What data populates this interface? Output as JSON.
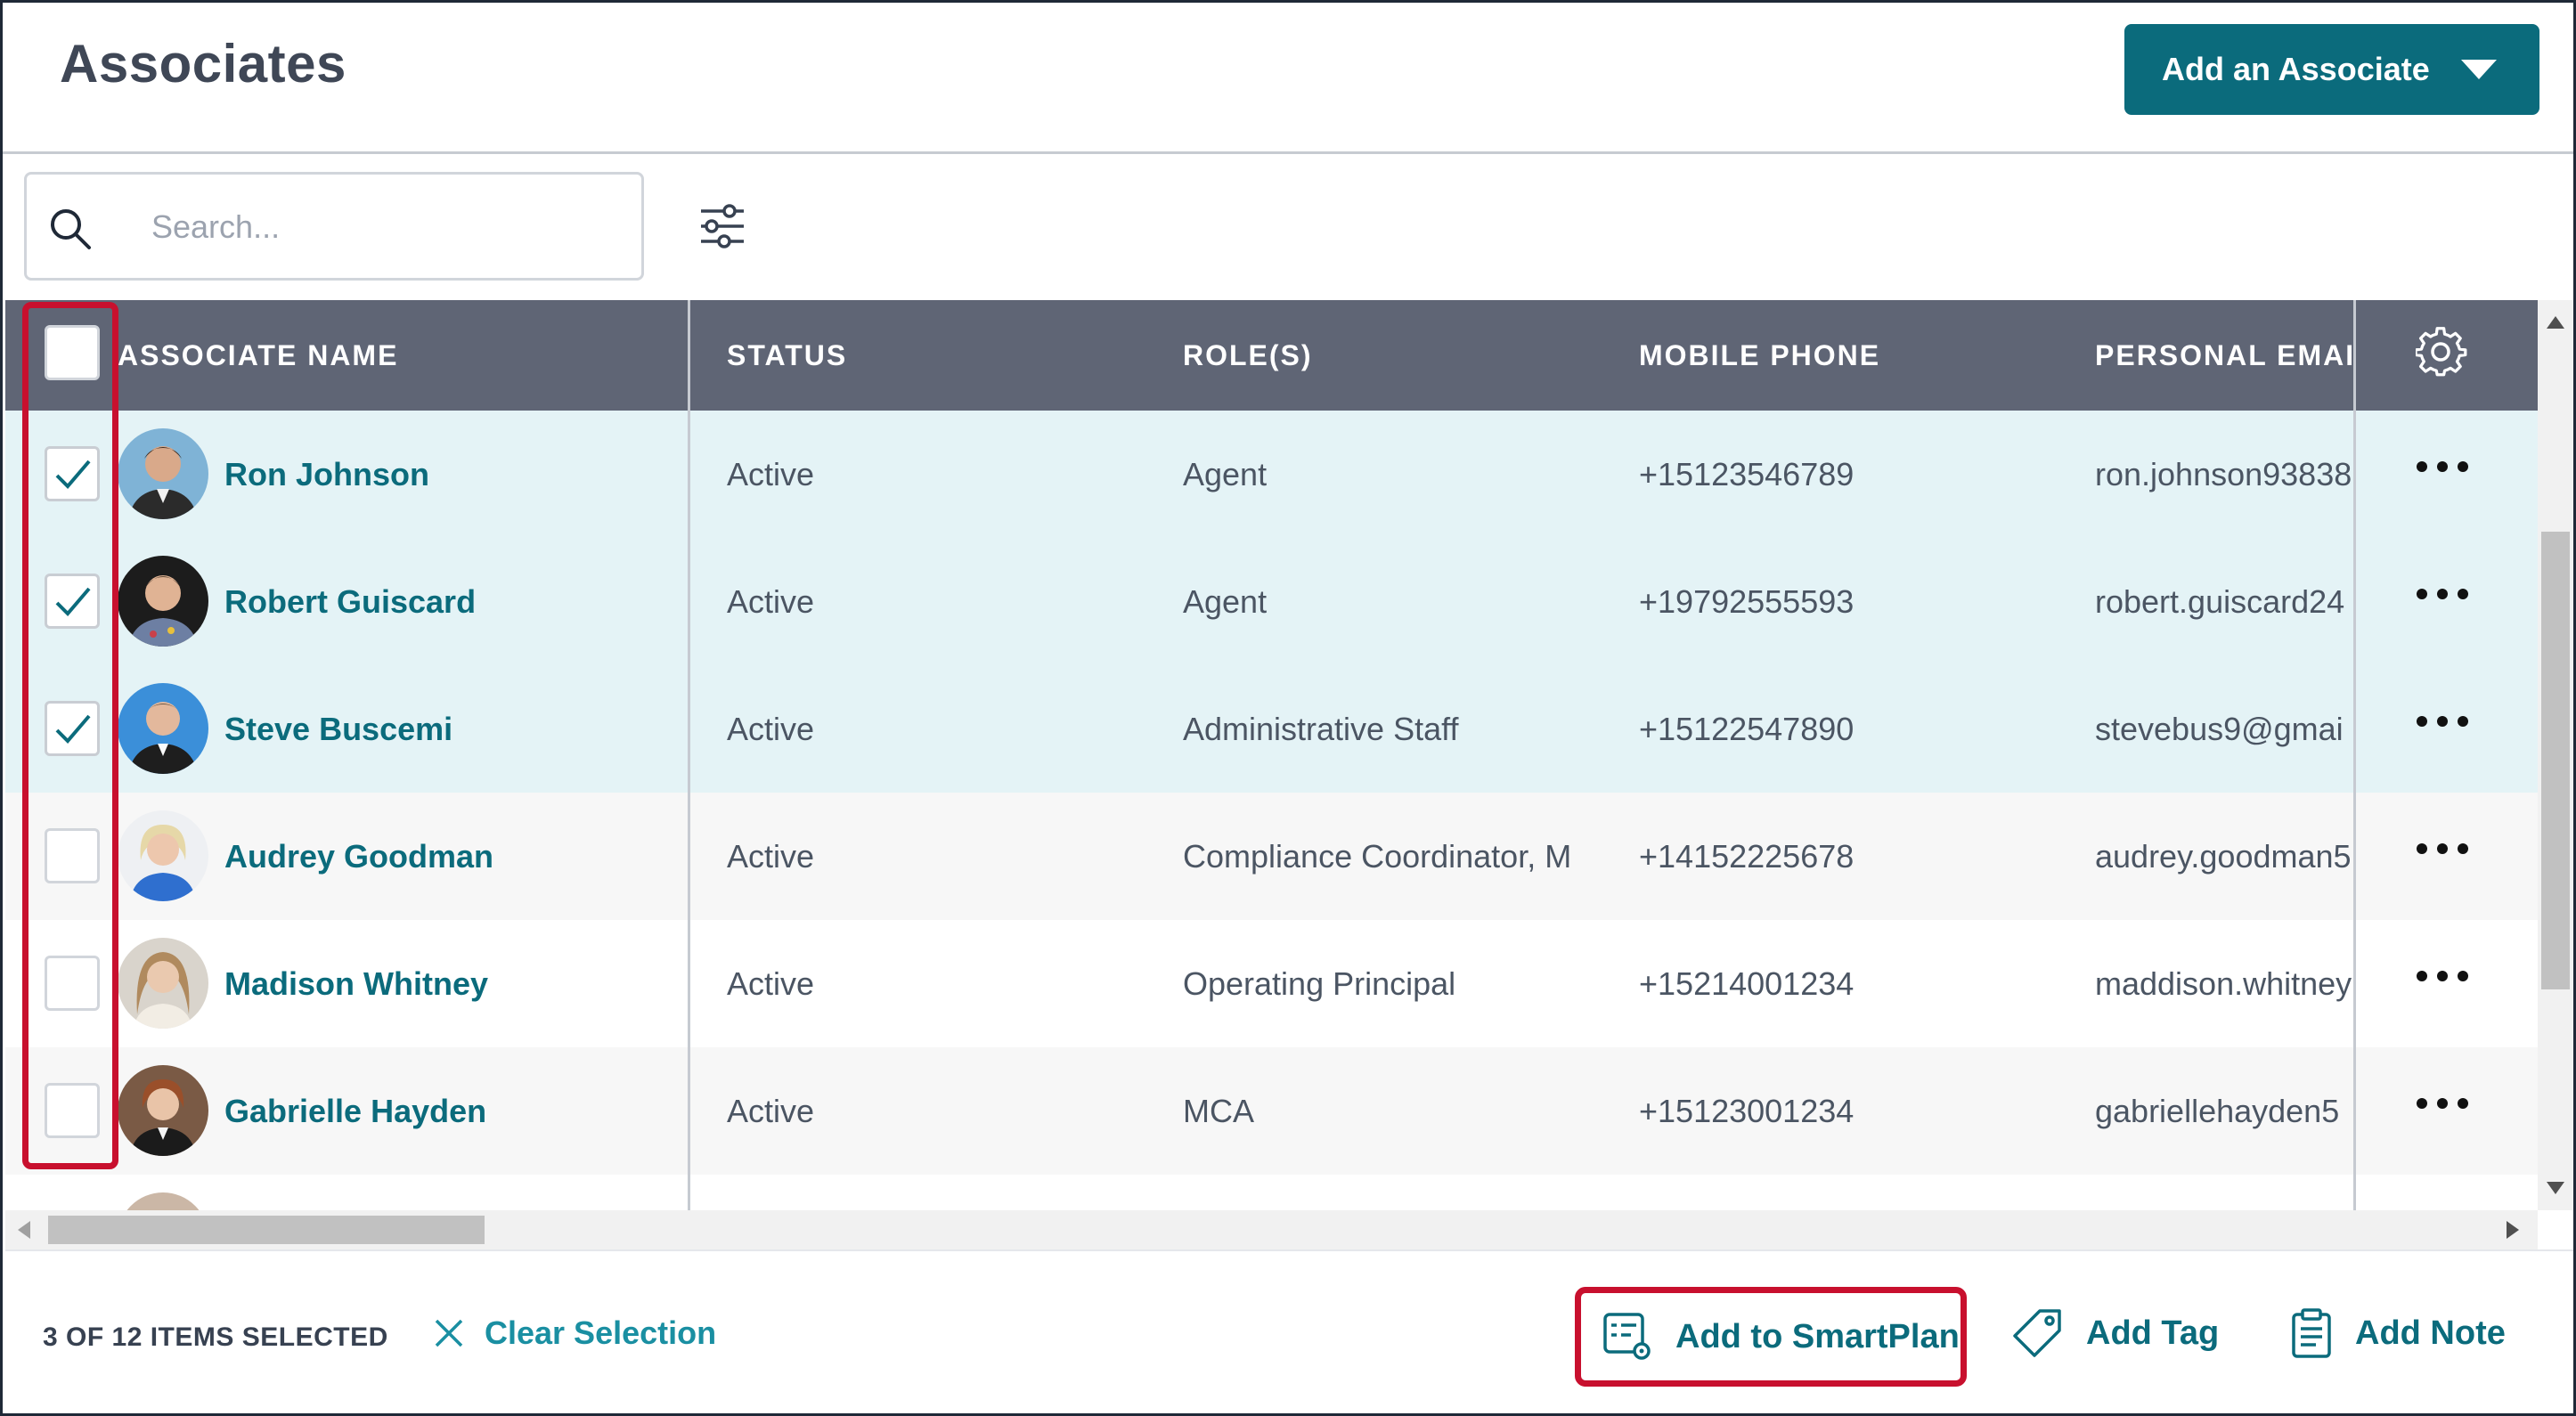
{
  "header": {
    "title": "Associates",
    "add_button_label": "Add an Associate"
  },
  "search": {
    "placeholder": "Search...",
    "value": ""
  },
  "table": {
    "columns": [
      "ASSOCIATE NAME",
      "STATUS",
      "ROLE(S)",
      "MOBILE PHONE",
      "PERSONAL EMAI"
    ],
    "rows": [
      {
        "name": "Ron Johnson",
        "status": "Active",
        "role": "Agent",
        "phone": "+15123546789",
        "email": "ron.johnson93838",
        "checked": true
      },
      {
        "name": "Robert Guiscard",
        "status": "Active",
        "role": "Agent",
        "phone": "+19792555593",
        "email": "robert.guiscard24",
        "checked": true
      },
      {
        "name": "Steve Buscemi",
        "status": "Active",
        "role": "Administrative Staff",
        "phone": "+15122547890",
        "email": "stevebus9@gmai",
        "checked": true
      },
      {
        "name": "Audrey Goodman",
        "status": "Active",
        "role": "Compliance Coordinator, M",
        "phone": "+14152225678",
        "email": "audrey.goodman5",
        "checked": false
      },
      {
        "name": "Madison Whitney",
        "status": "Active",
        "role": "Operating Principal",
        "phone": "+15214001234",
        "email": "maddison.whitney",
        "checked": false
      },
      {
        "name": "Gabrielle Hayden",
        "status": "Active",
        "role": "MCA",
        "phone": "+15123001234",
        "email": "gabriellehayden5",
        "checked": false
      }
    ]
  },
  "footer": {
    "selected_count": "3 OF 12 ITEMS SELECTED",
    "clear_selection": "Clear Selection",
    "add_to_smartplan": "Add to SmartPlan",
    "add_tag": "Add Tag",
    "add_note": "Add Note"
  },
  "colors": {
    "accent": "#0b6b7c",
    "header_bg": "#5f6575",
    "selected_row": "#e4f3f6",
    "highlight": "#c8102e"
  }
}
